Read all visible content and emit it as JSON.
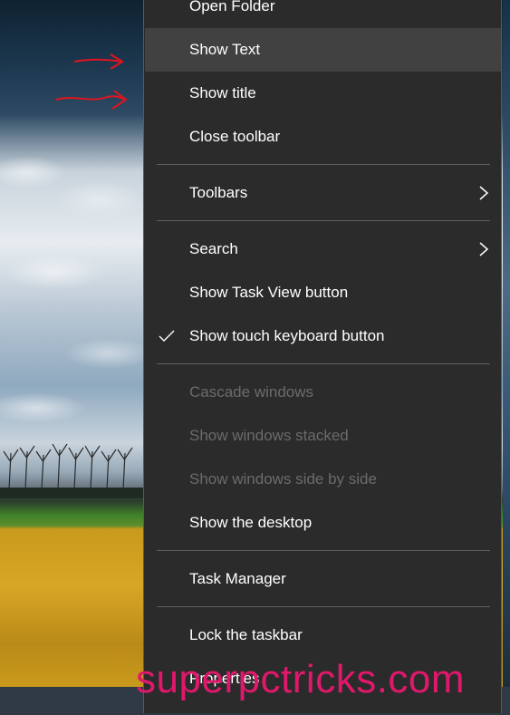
{
  "menu": {
    "items": [
      {
        "label": "Open Folder"
      },
      {
        "label": "Show Text"
      },
      {
        "label": "Show title"
      },
      {
        "label": "Close toolbar"
      },
      {
        "label": "Toolbars"
      },
      {
        "label": "Search"
      },
      {
        "label": "Show Task View button"
      },
      {
        "label": "Show touch keyboard button"
      },
      {
        "label": "Cascade windows"
      },
      {
        "label": "Show windows stacked"
      },
      {
        "label": "Show windows side by side"
      },
      {
        "label": "Show the desktop"
      },
      {
        "label": "Task Manager"
      },
      {
        "label": "Lock the taskbar"
      },
      {
        "label": "Properties"
      }
    ]
  },
  "watermark": "superpctricks.com",
  "colors": {
    "menu_bg": "#2b2b2b",
    "hover_bg": "#414141",
    "text": "#ffffff",
    "disabled_text": "#6b6b6b",
    "separator": "#5e5e5e",
    "annotation_arrow": "#e0141e",
    "watermark": "#e0186c"
  }
}
